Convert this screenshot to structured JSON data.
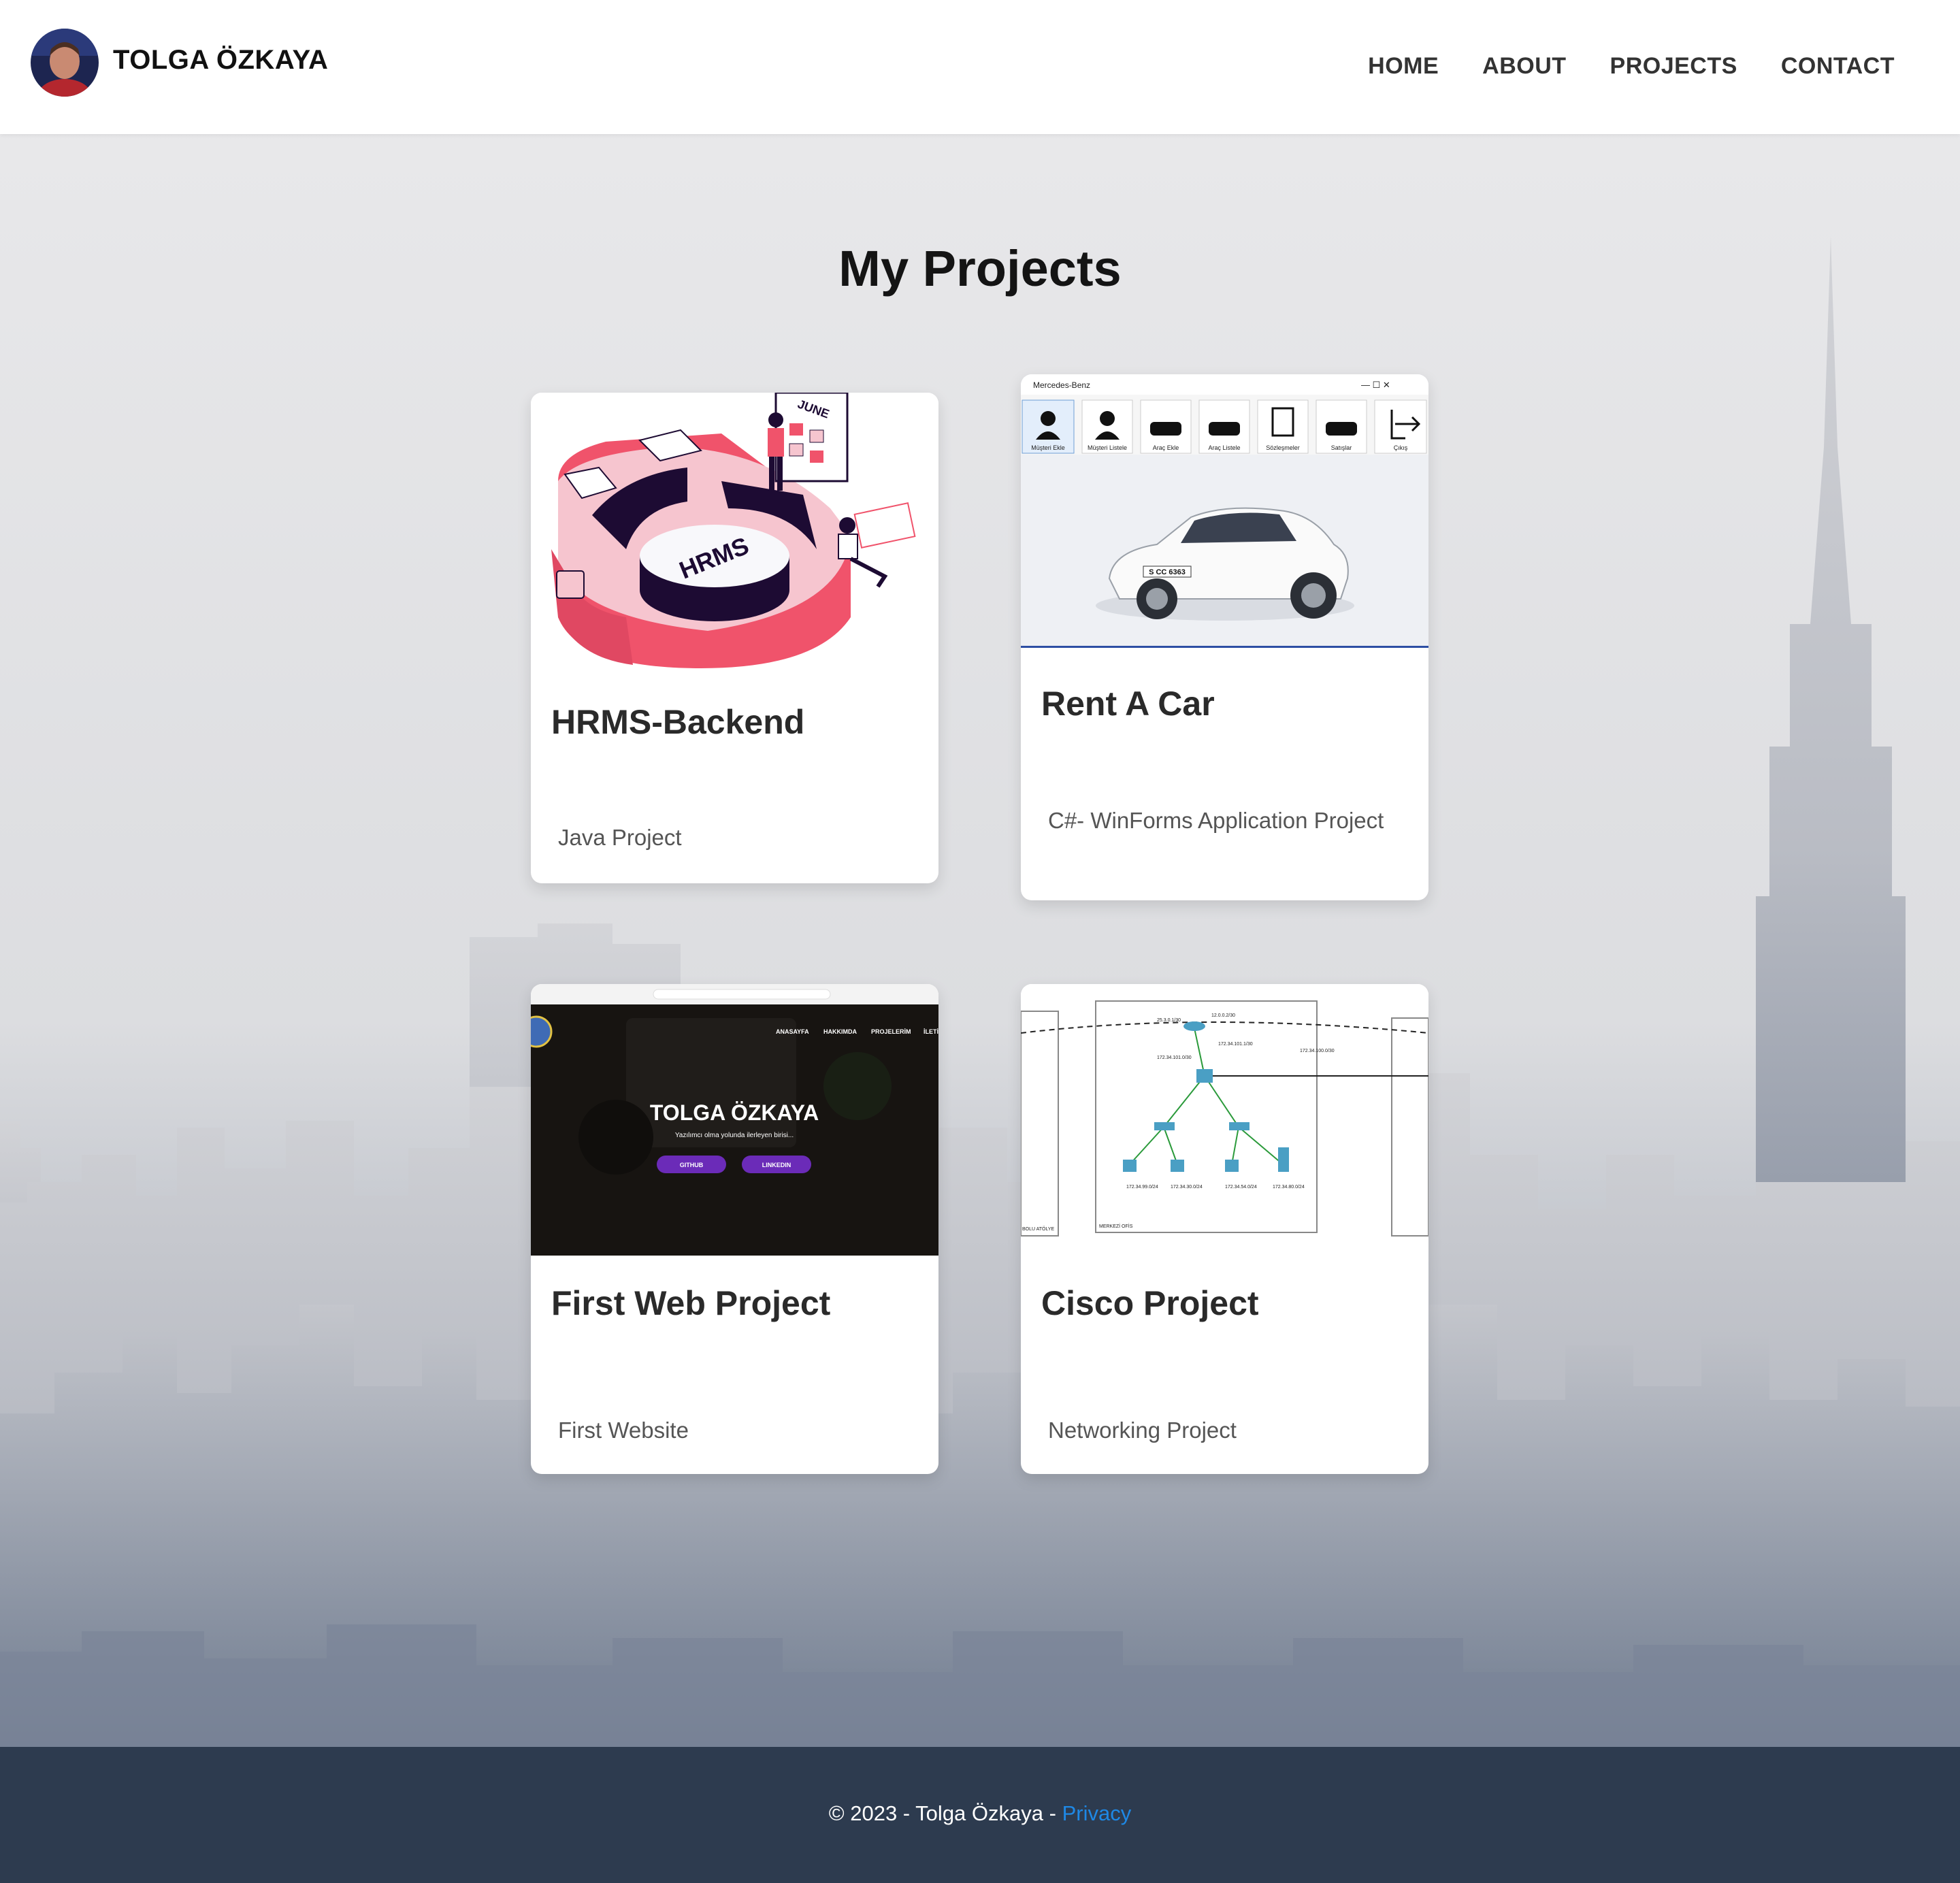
{
  "header": {
    "brand": "TOLGA ÖZKAYA",
    "nav": [
      "HOME",
      "ABOUT",
      "PROJECTS",
      "CONTACT"
    ]
  },
  "main": {
    "title": "My Projects",
    "cards": [
      {
        "title": "HRMS-Backend",
        "description": "Java Project",
        "image_text": "HRMS",
        "image_text2": "JUNE"
      },
      {
        "title": "Rent A Car",
        "description": "C#- WinForms Application Project",
        "window_title": "Mercedes-Benz",
        "toolbar": [
          "Müşteri Ekle",
          "Müşteri Listele",
          "Araç Ekle",
          "Araç Listele",
          "Sözleşmeler",
          "Satışlar",
          "Çıkış"
        ],
        "plate": "S CC 6363"
      },
      {
        "title": "First Web Project",
        "description": "First Website",
        "hero_name": "TOLGA ÖZKAYA",
        "hero_sub": "Yazılımcı olma yolunda ilerleyen birisi...",
        "hero_nav": [
          "ANASAYFA",
          "HAKKIMDA",
          "PROJELERİM",
          "İLETİ"
        ],
        "buttons": [
          "GITHUB",
          "LINKEDIN"
        ]
      },
      {
        "title": "Cisco Project",
        "description": "Networking Project",
        "labels": [
          "MERKEZİ OFİS",
          "BOLU ATÖLYE"
        ]
      }
    ]
  },
  "footer": {
    "copyright": "© 2023 - Tolga Özkaya - ",
    "privacy": "Privacy"
  },
  "colors": {
    "accent": "#1e88e5",
    "footer_bg": "#2d3b4f",
    "hrms_pink": "#f0536b",
    "hrms_navy": "#1d0b33",
    "web_purple": "#6b2bb8"
  }
}
